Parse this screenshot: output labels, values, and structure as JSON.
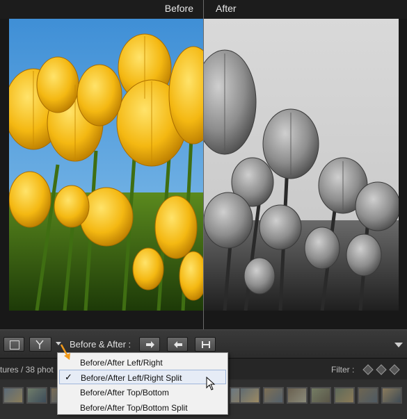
{
  "header": {
    "before_label": "Before",
    "after_label": "After"
  },
  "toolbar": {
    "before_after_label": "Before & After :",
    "buttons": [
      "loupe-view",
      "before-after-view",
      "swap",
      "copy-before",
      "copy-after"
    ]
  },
  "menu": {
    "items": [
      {
        "label": "Before/After Left/Right",
        "checked": false,
        "highlighted": false
      },
      {
        "label": "Before/After Left/Right Split",
        "checked": true,
        "highlighted": true
      },
      {
        "label": "Before/After Top/Bottom",
        "checked": false,
        "highlighted": false
      },
      {
        "label": "Before/After Top/Bottom Split",
        "checked": false,
        "highlighted": false
      }
    ],
    "check_glyph": "✓"
  },
  "infobar": {
    "text": "tures / 38 phot",
    "filter_label": "Filter :"
  },
  "colors": {
    "accent_arrow": "#f29a1a",
    "menu_bg": "#f1f1f1",
    "menu_highlight": "#e6ecf6"
  }
}
